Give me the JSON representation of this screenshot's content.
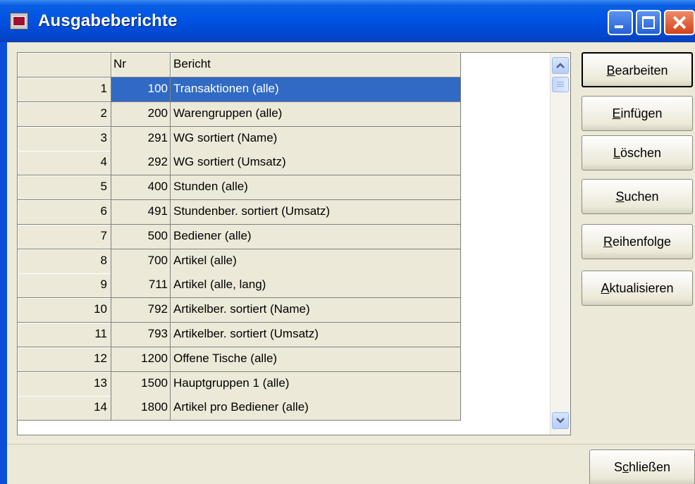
{
  "window": {
    "title": "Ausgabeberichte"
  },
  "grid": {
    "headers": {
      "nr": "Nr",
      "bericht": "Bericht"
    },
    "selected_row": 0,
    "rows": [
      {
        "idx": "1",
        "nr": "100",
        "bericht": "Transaktionen (alle)"
      },
      {
        "idx": "2",
        "nr": "200",
        "bericht": "Warengruppen (alle)"
      },
      {
        "idx": "3",
        "nr": "291",
        "bericht": "WG sortiert (Name)"
      },
      {
        "idx": "4",
        "nr": "292",
        "bericht": "WG sortiert (Umsatz)"
      },
      {
        "idx": "5",
        "nr": "400",
        "bericht": "Stunden (alle)"
      },
      {
        "idx": "6",
        "nr": "491",
        "bericht": "Stundenber. sortiert (Umsatz)"
      },
      {
        "idx": "7",
        "nr": "500",
        "bericht": "Bediener (alle)"
      },
      {
        "idx": "8",
        "nr": "700",
        "bericht": "Artikel (alle)"
      },
      {
        "idx": "9",
        "nr": "711",
        "bericht": "Artikel (alle, lang)"
      },
      {
        "idx": "10",
        "nr": "792",
        "bericht": "Artikelber. sortiert (Name)"
      },
      {
        "idx": "11",
        "nr": "793",
        "bericht": "Artikelber. sortiert (Umsatz)"
      },
      {
        "idx": "12",
        "nr": "1200",
        "bericht": "Offene Tische (alle)"
      },
      {
        "idx": "13",
        "nr": "1500",
        "bericht": "Hauptgruppen 1 (alle)"
      },
      {
        "idx": "14",
        "nr": "1800",
        "bericht": "Artikel pro Bediener (alle)"
      }
    ]
  },
  "buttons": {
    "bearbeiten": {
      "accel": "B",
      "rest": "earbeiten"
    },
    "einfuegen": {
      "accel": "E",
      "rest": "infügen"
    },
    "loeschen": {
      "accel": "L",
      "rest": "öschen"
    },
    "suchen": {
      "accel": "S",
      "rest": "uchen"
    },
    "reihenfolge": {
      "accel": "R",
      "rest": "eihenfolge"
    },
    "aktualisieren": {
      "accel": "A",
      "rest": "ktualisieren"
    },
    "schliessen": {
      "pre": "S",
      "accel": "c",
      "rest": "hließen"
    }
  },
  "colors": {
    "selection": "#316ac5",
    "titlebar": "#0055e5"
  }
}
